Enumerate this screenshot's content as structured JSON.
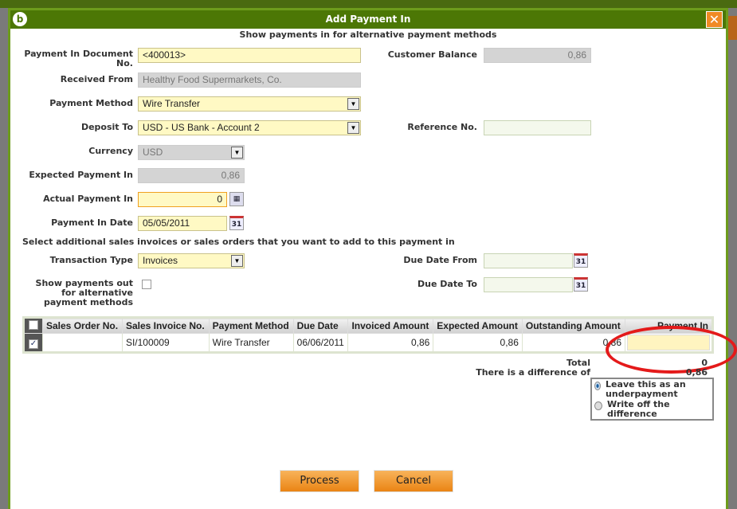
{
  "dialog": {
    "title": "Add Payment In",
    "subtitle": "Show payments in for alternative payment methods"
  },
  "form": {
    "doc_no_label": "Payment In Document No.",
    "doc_no": "<400013>",
    "customer_balance_label": "Customer Balance",
    "customer_balance": "0,86",
    "received_from_label": "Received From",
    "received_from": "Healthy Food Supermarkets, Co.",
    "payment_method_label": "Payment Method",
    "payment_method": "Wire Transfer",
    "deposit_to_label": "Deposit To",
    "deposit_to": "USD - US Bank - Account 2",
    "reference_label": "Reference No.",
    "reference": "",
    "currency_label": "Currency",
    "currency": "USD",
    "expected_label": "Expected Payment In",
    "expected": "0,86",
    "actual_label": "Actual Payment In",
    "actual": "0",
    "date_label": "Payment In Date",
    "date": "05/05/2011",
    "select_text": "Select additional sales invoices or sales orders that you want to add to this payment in",
    "txn_type_label": "Transaction Type",
    "txn_type": "Invoices",
    "due_from_label": "Due Date From",
    "due_from": "",
    "due_to_label": "Due Date To",
    "due_to": "",
    "show_out_label": "Show payments out for alternative payment methods",
    "calendar_text": "31"
  },
  "table": {
    "headers": [
      "Sales Order No.",
      "Sales Invoice No.",
      "Payment Method",
      "Due Date",
      "Invoiced Amount",
      "Expected Amount",
      "Outstanding Amount",
      "Payment In"
    ],
    "rows": [
      {
        "order": "",
        "invoice": "SI/100009",
        "method": "Wire Transfer",
        "due": "06/06/2011",
        "invoiced": "0,86",
        "expected": "0,86",
        "outstanding": "0,86",
        "payment": ""
      }
    ]
  },
  "summary": {
    "total_label": "Total",
    "total": "0",
    "diff_label": "There is a difference of",
    "diff": "0,86",
    "opt1": "Leave this as an underpayment",
    "opt2": "Write off the difference"
  },
  "buttons": {
    "process": "Process",
    "cancel": "Cancel"
  }
}
